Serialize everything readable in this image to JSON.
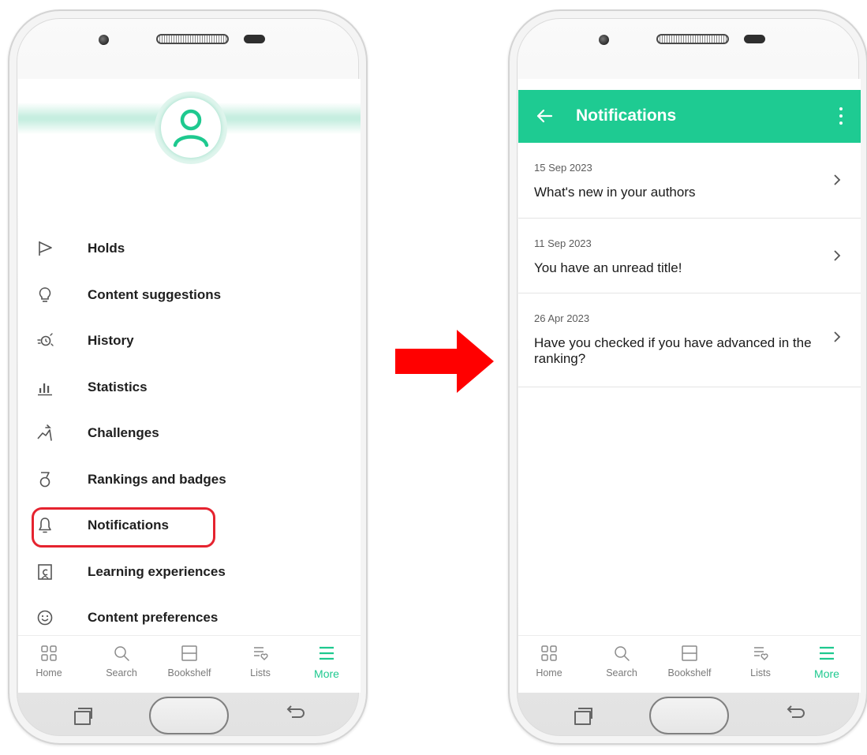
{
  "colors": {
    "accent": "#1ecb92",
    "highlight": "#e5232f",
    "arrow": "#ff0000"
  },
  "left_screen": {
    "menu": [
      {
        "icon": "flag-icon",
        "label": "Holds"
      },
      {
        "icon": "lightbulb-icon",
        "label": "Content suggestions"
      },
      {
        "icon": "history-icon",
        "label": "History"
      },
      {
        "icon": "bar-chart-icon",
        "label": "Statistics"
      },
      {
        "icon": "challenge-icon",
        "label": "Challenges"
      },
      {
        "icon": "medal-icon",
        "label": "Rankings and badges"
      },
      {
        "icon": "bell-icon",
        "label": "Notifications",
        "highlighted": true
      },
      {
        "icon": "bookmark-icon",
        "label": "Learning experiences"
      },
      {
        "icon": "smiley-icon",
        "label": "Content preferences"
      }
    ]
  },
  "bottom_nav": [
    {
      "icon": "grid-icon",
      "label": "Home"
    },
    {
      "icon": "search-icon",
      "label": "Search"
    },
    {
      "icon": "bookshelf-icon",
      "label": "Bookshelf"
    },
    {
      "icon": "list-heart-icon",
      "label": "Lists"
    },
    {
      "icon": "menu-icon",
      "label": "More",
      "active": true
    }
  ],
  "right_screen": {
    "title": "Notifications",
    "notifications": [
      {
        "date": "15 Sep 2023",
        "text": "What's new in your authors"
      },
      {
        "date": "11 Sep 2023",
        "text": "You have an unread title!"
      },
      {
        "date": "26 Apr 2023",
        "text": "Have you checked if you have advanced in the ranking?"
      }
    ]
  }
}
